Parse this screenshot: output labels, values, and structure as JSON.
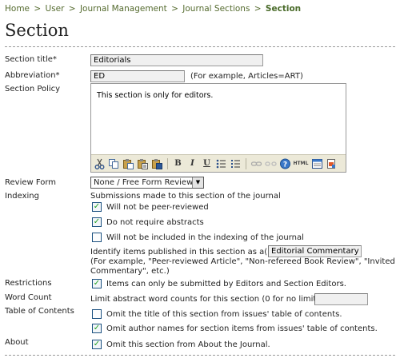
{
  "breadcrumb": {
    "items": [
      "Home",
      "User",
      "Journal Management",
      "Journal Sections"
    ],
    "current": "Section",
    "separator": ">"
  },
  "page_title": "Section",
  "fields": {
    "section_title": {
      "label": "Section title*",
      "value": "Editorials"
    },
    "abbreviation": {
      "label": "Abbreviation*",
      "value": "ED",
      "hint": "(For example, Articles=ART)"
    },
    "section_policy": {
      "label": "Section Policy",
      "value": "This section is only for editors."
    },
    "review_form": {
      "label": "Review Form",
      "selected": "None / Free Form Review"
    },
    "indexing": {
      "label": "Indexing",
      "intro": "Submissions made to this section of the journal",
      "options": [
        {
          "label": "Will not be peer-reviewed",
          "checked": true
        },
        {
          "label": "Do not require abstracts",
          "checked": true
        },
        {
          "label": "Will not be included in the indexing of the journal",
          "checked": false
        }
      ],
      "identify_label": "Identify items published in this section as a(n)",
      "identify_value": "Editorial Commentary",
      "example_line1": "(For example, \"Peer-reviewed Article\", \"Non-refereed Book Review\", \"Invited",
      "example_line2": "Commentary\", etc.)"
    },
    "restrictions": {
      "label": "Restrictions",
      "option": "Items can only be submitted by Editors and Section Editors.",
      "checked": true
    },
    "word_count": {
      "label": "Word Count",
      "text": "Limit abstract word counts for this section (0 for no limit):",
      "value": ""
    },
    "table_of_contents": {
      "label": "Table of Contents",
      "options": [
        {
          "label": "Omit the title of this section from issues' table of contents.",
          "checked": false
        },
        {
          "label": "Omit author names for section items from issues' table of contents.",
          "checked": true
        }
      ]
    },
    "about": {
      "label": "About",
      "option": "Omit this section from About the Journal.",
      "checked": true
    }
  },
  "toolbar": {
    "icons": [
      "cut-icon",
      "copy-icon",
      "paste-icon",
      "paste-text-icon",
      "paste-word-icon",
      "bold-icon",
      "italic-icon",
      "underline-icon",
      "bullet-list-icon",
      "numbered-list-icon",
      "link-icon",
      "unlink-icon",
      "help-icon",
      "html-icon",
      "fullscreen-icon",
      "upload-icon"
    ],
    "glyphs": {
      "bold": "B",
      "italic": "I",
      "underline": "U",
      "html": "HTML",
      "help": "?"
    }
  },
  "colors": {
    "breadcrumb": "#556b2f",
    "check": "#21a121",
    "input_bg": "#f0f0f0"
  }
}
